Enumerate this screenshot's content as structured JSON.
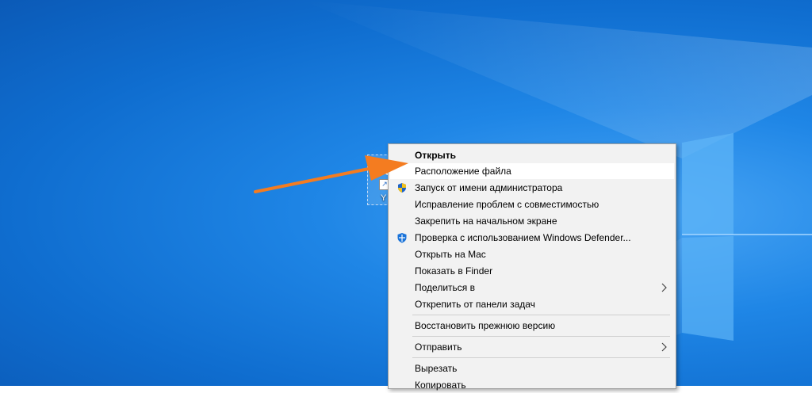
{
  "desktop": {
    "icon_caption": "Y"
  },
  "context_menu": {
    "items": [
      {
        "label": "Открыть",
        "bold": true
      },
      {
        "label": "Расположение файла",
        "highlighted": true
      },
      {
        "label": "Запуск от имени администратора",
        "icon": "uac-shield-icon"
      },
      {
        "label": "Исправление проблем с совместимостью"
      },
      {
        "label": "Закрепить на начальном экране"
      },
      {
        "label": "Проверка с использованием Windows Defender...",
        "icon": "windows-defender-icon"
      },
      {
        "label": "Открыть на Mac"
      },
      {
        "label": "Показать в Finder"
      },
      {
        "label": "Поделиться в",
        "submenu": true
      },
      {
        "label": "Открепить от панели задач"
      },
      {
        "label": "Восстановить прежнюю версию"
      },
      {
        "label": "Отправить",
        "submenu": true
      },
      {
        "label": "Вырезать"
      },
      {
        "label": "Копировать"
      }
    ]
  },
  "colors": {
    "annotation_arrow": "#f47c20",
    "desktop_blue": "#1f86e6",
    "menu_background": "#f2f2f2"
  }
}
